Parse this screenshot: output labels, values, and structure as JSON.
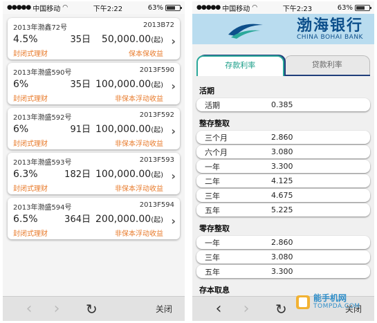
{
  "left": {
    "status": {
      "carrier": "中国移动",
      "time": "下午2:22",
      "battery": "63%"
    },
    "products": [
      {
        "name": "2013年渤鑫72号",
        "code": "2013B72",
        "rate": "4.5%",
        "days": "35日",
        "amount": "50,000.00",
        "amount_unit": "(起)",
        "type": "封闭式理财",
        "guarantee": "保本保收益"
      },
      {
        "name": "2013年渤盛590号",
        "code": "2013F590",
        "rate": "6%",
        "days": "35日",
        "amount": "100,000.00",
        "amount_unit": "(起)",
        "type": "封闭式理财",
        "guarantee": "非保本浮动收益"
      },
      {
        "name": "2013年渤盛592号",
        "code": "2013F592",
        "rate": "6%",
        "days": "91日",
        "amount": "100,000.00",
        "amount_unit": "(起)",
        "type": "封闭式理财",
        "guarantee": "非保本浮动收益"
      },
      {
        "name": "2013年渤盛593号",
        "code": "2013F593",
        "rate": "6.3%",
        "days": "182日",
        "amount": "100,000.00",
        "amount_unit": "(起)",
        "type": "封闭式理财",
        "guarantee": "非保本浮动收益"
      },
      {
        "name": "2013年渤盛594号",
        "code": "2013F594",
        "rate": "6.5%",
        "days": "364日",
        "amount": "200,000.00",
        "amount_unit": "(起)",
        "type": "封闭式理财",
        "guarantee": "非保本浮动收益"
      }
    ],
    "toolbar": {
      "close": "关闭"
    }
  },
  "right": {
    "status": {
      "carrier": "中国移动",
      "time": "下午2:23",
      "battery": "63%"
    },
    "bank": {
      "name_cn": "渤海银行",
      "name_en": "CHINA BOHAI BANK"
    },
    "tabs": {
      "deposit": "存款利率",
      "loan": "贷款利率"
    },
    "sections": [
      {
        "title": "活期",
        "rows": [
          {
            "term": "活期",
            "rate": "0.385"
          }
        ]
      },
      {
        "title": "整存整取",
        "rows": [
          {
            "term": "三个月",
            "rate": "2.860"
          },
          {
            "term": "六个月",
            "rate": "3.080"
          },
          {
            "term": "一年",
            "rate": "3.300"
          },
          {
            "term": "二年",
            "rate": "4.125"
          },
          {
            "term": "三年",
            "rate": "4.675"
          },
          {
            "term": "五年",
            "rate": "5.225"
          }
        ]
      },
      {
        "title": "零存整取",
        "rows": [
          {
            "term": "一年",
            "rate": "2.860"
          },
          {
            "term": "三年",
            "rate": "3.080"
          },
          {
            "term": "五年",
            "rate": "3.300"
          }
        ]
      },
      {
        "title": "存本取息",
        "rows": []
      }
    ],
    "toolbar": {
      "close": "关闭"
    }
  },
  "watermark": {
    "text": "能手机网",
    "url": "TOMPDA.COM"
  },
  "colors": {
    "accent_orange": "#e87a2a",
    "tab_teal": "#1a9e88",
    "banner_blue": "#b9dcef",
    "bank_navy": "#0d4f8b"
  }
}
